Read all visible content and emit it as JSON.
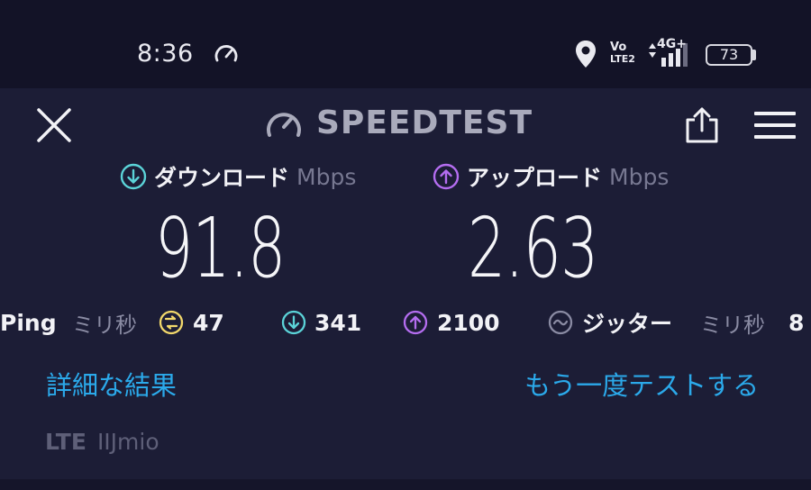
{
  "status_bar": {
    "time": "8:36",
    "volte_top": "Vo",
    "volte_bottom": "LTE2",
    "network": "4G+",
    "battery": "73"
  },
  "header": {
    "brand": "SPEEDTEST"
  },
  "download": {
    "label": "ダウンロード",
    "unit": "Mbps",
    "value": "91.8",
    "color": "#5bd3d8"
  },
  "upload": {
    "label": "アップロード",
    "unit": "Mbps",
    "value": "2.63",
    "color": "#b46df0"
  },
  "ping": {
    "label": "Ping",
    "unit": "ミリ秒",
    "idle_value": "47",
    "download_value": "341",
    "upload_value": "2100",
    "idle_color": "#f2d86b"
  },
  "jitter": {
    "label": "ジッター",
    "unit": "ミリ秒",
    "value": "8"
  },
  "actions": {
    "details": "詳細な結果",
    "retry": "もう一度テストする"
  },
  "connection": {
    "type": "LTE",
    "provider": "IIJmio"
  },
  "colors": {
    "link": "#2ba9ea",
    "background": "#1c1d36"
  }
}
